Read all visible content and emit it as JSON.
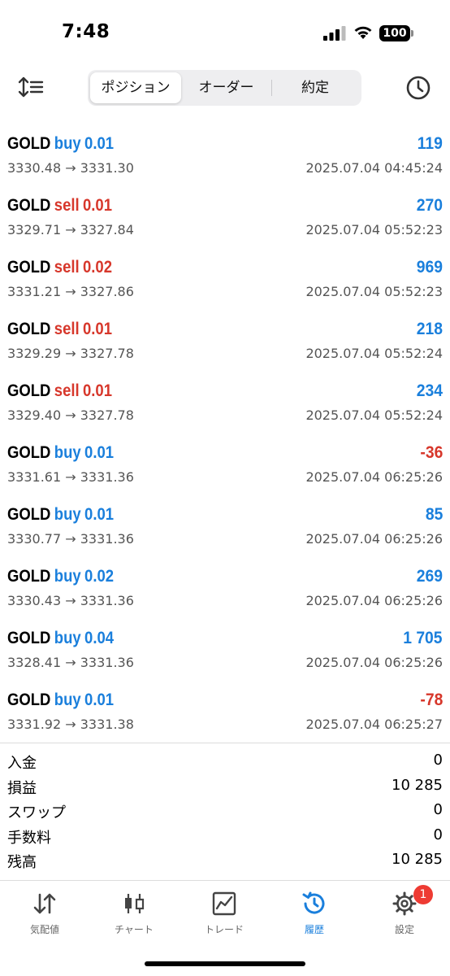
{
  "status_bar": {
    "time": "7:48",
    "battery": "100"
  },
  "toolbar": {
    "sort_icon": "sort-icon",
    "history_icon": "clock-icon",
    "tabs": [
      "ポジション",
      "オーダー",
      "約定"
    ],
    "selected_tab": "ポジション"
  },
  "deals": [
    {
      "symbol": "GOLD",
      "side": "buy",
      "volume": "0.01",
      "prices": "3330.48 → 3331.30",
      "time": "2025.07.04 04:45:24",
      "profit": "119",
      "profit_color": "#1a7fdc"
    },
    {
      "symbol": "GOLD",
      "side": "sell",
      "volume": "0.01",
      "prices": "3329.71 → 3327.84",
      "time": "2025.07.04 05:52:23",
      "profit": "270",
      "profit_color": "#1a7fdc"
    },
    {
      "symbol": "GOLD",
      "side": "sell",
      "volume": "0.02",
      "prices": "3331.21 → 3327.86",
      "time": "2025.07.04 05:52:23",
      "profit": "969",
      "profit_color": "#1a7fdc"
    },
    {
      "symbol": "GOLD",
      "side": "sell",
      "volume": "0.01",
      "prices": "3329.29 → 3327.78",
      "time": "2025.07.04 05:52:24",
      "profit": "218",
      "profit_color": "#1a7fdc"
    },
    {
      "symbol": "GOLD",
      "side": "sell",
      "volume": "0.01",
      "prices": "3329.40 → 3327.78",
      "time": "2025.07.04 05:52:24",
      "profit": "234",
      "profit_color": "#1a7fdc"
    },
    {
      "symbol": "GOLD",
      "side": "buy",
      "volume": "0.01",
      "prices": "3331.61 → 3331.36",
      "time": "2025.07.04 06:25:26",
      "profit": "-36",
      "profit_color": "#d7372b"
    },
    {
      "symbol": "GOLD",
      "side": "buy",
      "volume": "0.01",
      "prices": "3330.77 → 3331.36",
      "time": "2025.07.04 06:25:26",
      "profit": "85",
      "profit_color": "#1a7fdc"
    },
    {
      "symbol": "GOLD",
      "side": "buy",
      "volume": "0.02",
      "prices": "3330.43 → 3331.36",
      "time": "2025.07.04 06:25:26",
      "profit": "269",
      "profit_color": "#1a7fdc"
    },
    {
      "symbol": "GOLD",
      "side": "buy",
      "volume": "0.04",
      "prices": "3328.41 → 3331.36",
      "time": "2025.07.04 06:25:26",
      "profit": "1 705",
      "profit_color": "#1a7fdc"
    },
    {
      "symbol": "GOLD",
      "side": "buy",
      "volume": "0.01",
      "prices": "3331.92 → 3331.38",
      "time": "2025.07.04 06:25:27",
      "profit": "-78",
      "profit_color": "#d7372b"
    }
  ],
  "side_colors": {
    "buy": "#1a7fdc",
    "sell": "#d7372b"
  },
  "summary": [
    {
      "label": "入金",
      "value": "0"
    },
    {
      "label": "損益",
      "value": "10 285"
    },
    {
      "label": "スワップ",
      "value": "0"
    },
    {
      "label": "手数料",
      "value": "0"
    },
    {
      "label": "残高",
      "value": "10 285"
    }
  ],
  "tabbar": {
    "items": [
      {
        "label": "気配値",
        "icon": "quotes-icon",
        "active": false
      },
      {
        "label": "チャート",
        "icon": "chart-icon",
        "active": false
      },
      {
        "label": "トレード",
        "icon": "trade-icon",
        "active": false
      },
      {
        "label": "履歴",
        "icon": "history-icon",
        "active": true
      },
      {
        "label": "設定",
        "icon": "settings-icon",
        "active": false
      }
    ],
    "settings_badge": "1"
  }
}
